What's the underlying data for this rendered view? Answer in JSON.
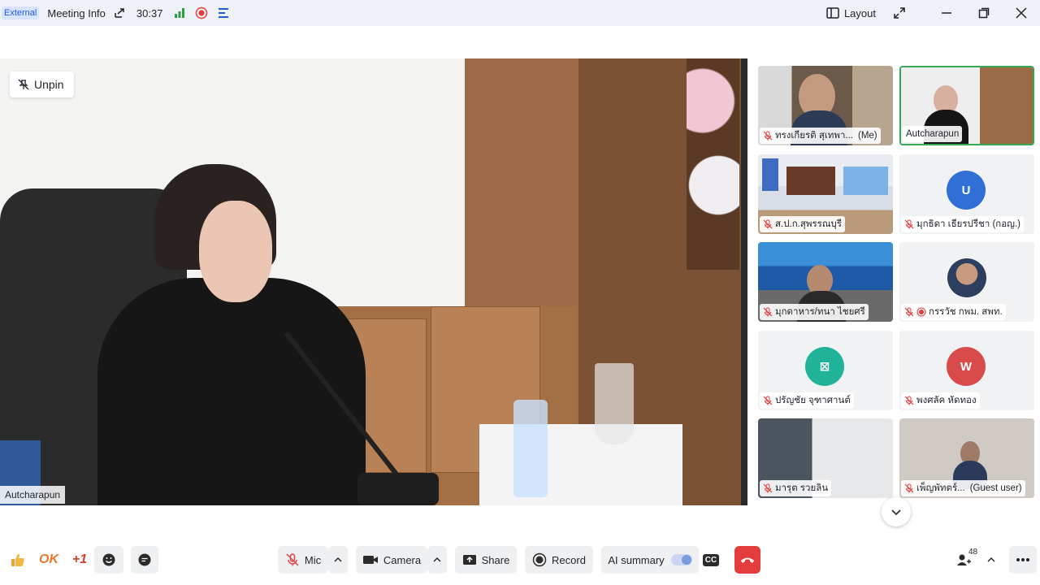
{
  "topbar": {
    "external_badge": "External",
    "meeting_info": "Meeting Info",
    "timer": "30:37",
    "layout_label": "Layout"
  },
  "main": {
    "unpin_label": "Unpin",
    "speaker_name": "Autcharapun"
  },
  "participants": [
    {
      "name": "ทรงเกียรติ สุเทพา...",
      "suffix": "(Me)",
      "type": "video",
      "muted": true,
      "active": false
    },
    {
      "name": "Autcharapun",
      "suffix": "",
      "type": "video",
      "muted": false,
      "active": true
    },
    {
      "name": "ส.ป.ก.สุพรรณบุรี",
      "suffix": "",
      "type": "video",
      "muted": true,
      "active": false
    },
    {
      "name": "มุกธิดา เธียรปรีชา (กอญ.)",
      "suffix": "",
      "type": "avatar",
      "avatar_letter": "U",
      "avatar_color": "#2f6fd6",
      "muted": true,
      "active": false
    },
    {
      "name": "มุกดาหาร/ทนา ไชยศรี",
      "suffix": "",
      "type": "video",
      "muted": true,
      "active": false
    },
    {
      "name": "กรรวัช กพม. สพท.",
      "suffix": "",
      "type": "photo",
      "muted": true,
      "recording": true,
      "active": false
    },
    {
      "name": "ปรัญชัย จุฑาศานต์",
      "suffix": "",
      "type": "avatar",
      "avatar_letter": "⊠",
      "avatar_color": "#1fb39a",
      "muted": true,
      "active": false
    },
    {
      "name": "พงศลัค หัดทอง",
      "suffix": "",
      "type": "avatar",
      "avatar_letter": "W",
      "avatar_color": "#d94b4b",
      "muted": true,
      "active": false
    },
    {
      "name": "มารุต รวยลิน",
      "suffix": "",
      "type": "video",
      "muted": true,
      "active": false
    },
    {
      "name": "เพ็ญพัทตร์...",
      "suffix": "(Guest user)",
      "type": "video",
      "muted": true,
      "active": false
    }
  ],
  "toolbar": {
    "reaction_ok": "OK",
    "reaction_plus_one": "+1",
    "mic_label": "Mic",
    "camera_label": "Camera",
    "share_label": "Share",
    "record_label": "Record",
    "ai_summary_label": "AI summary",
    "cc_label": "CC",
    "participants_count": "48"
  },
  "colors": {
    "accent": "#245bdb",
    "hangup": "#e23c3c",
    "active_border": "#34a853",
    "record_red": "#e23c3c",
    "signal_green": "#2ea043"
  }
}
